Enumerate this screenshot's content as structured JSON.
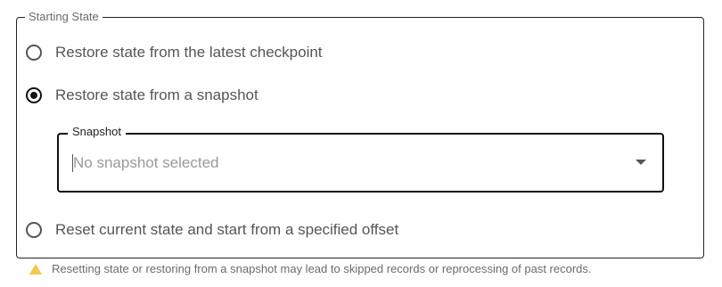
{
  "fieldset": {
    "legend": "Starting State"
  },
  "options": [
    {
      "label": "Restore state from the latest checkpoint",
      "checked": false
    },
    {
      "label": "Restore state from a snapshot",
      "checked": true
    },
    {
      "label": "Reset current state and start from a specified offset",
      "checked": false
    }
  ],
  "snapshot_select": {
    "label": "Snapshot",
    "placeholder": "No snapshot selected"
  },
  "warning": {
    "icon": "warning-icon",
    "text": "Resetting state or restoring from a snapshot may lead to skipped records or reprocessing of past records.",
    "color": "#f2c94c"
  }
}
